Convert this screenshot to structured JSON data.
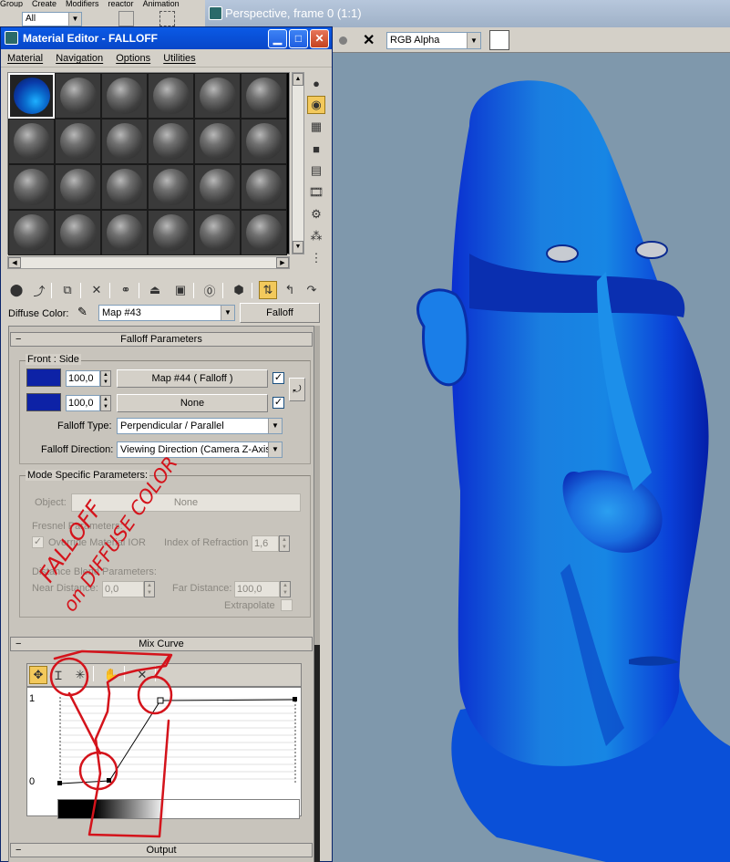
{
  "background_app": {
    "menu_items": [
      "Group",
      "Create",
      "Modifiers",
      "reactor",
      "Animation"
    ],
    "selection_filter": "All"
  },
  "viewport": {
    "title": "Perspective, frame 0 (1:1)",
    "channel": "RGB Alpha"
  },
  "material_editor": {
    "title": "Material Editor - FALLOFF",
    "menu": [
      "Material",
      "Navigation",
      "Options",
      "Utilities"
    ],
    "diffuse_label": "Diffuse Color:",
    "map_name": "Map #43",
    "map_type": "Falloff",
    "falloff_rollout": {
      "title": "Falloff Parameters",
      "group_label": "Front : Side",
      "front_amount": "100,0",
      "front_map": "Map #44  ( Falloff )",
      "side_amount": "100,0",
      "side_map": "None",
      "falloff_type_label": "Falloff Type:",
      "falloff_type": "Perpendicular / Parallel",
      "falloff_direction_label": "Falloff Direction:",
      "falloff_direction": "Viewing Direction (Camera Z-Axis)",
      "mode_group_label": "Mode Specific Parameters:",
      "object_label": "Object:",
      "object_value": "None",
      "fresnel_label": "Fresnel Parameters:",
      "override_label": "Override Material IOR",
      "ior_label": "Index of Refraction",
      "ior_value": "1,6",
      "distance_label": "Distance Blend Parameters:",
      "near_label": "Near Distance:",
      "near_value": "0,0",
      "far_label": "Far Distance:",
      "far_value": "100,0",
      "extrapolate_label": "Extrapolate"
    },
    "mix_curve": {
      "title": "Mix Curve",
      "y_max_label": "1",
      "y_min_label": "0"
    },
    "output_title": "Output"
  },
  "annotation": {
    "line1": "FALLOFF",
    "line2": "on DIFFUSE COLOR",
    "color": "#d4131b"
  },
  "colors": {
    "front_color": "#0d22a6",
    "side_color": "#0d22a6",
    "title_bar": "#0a5ae6"
  }
}
